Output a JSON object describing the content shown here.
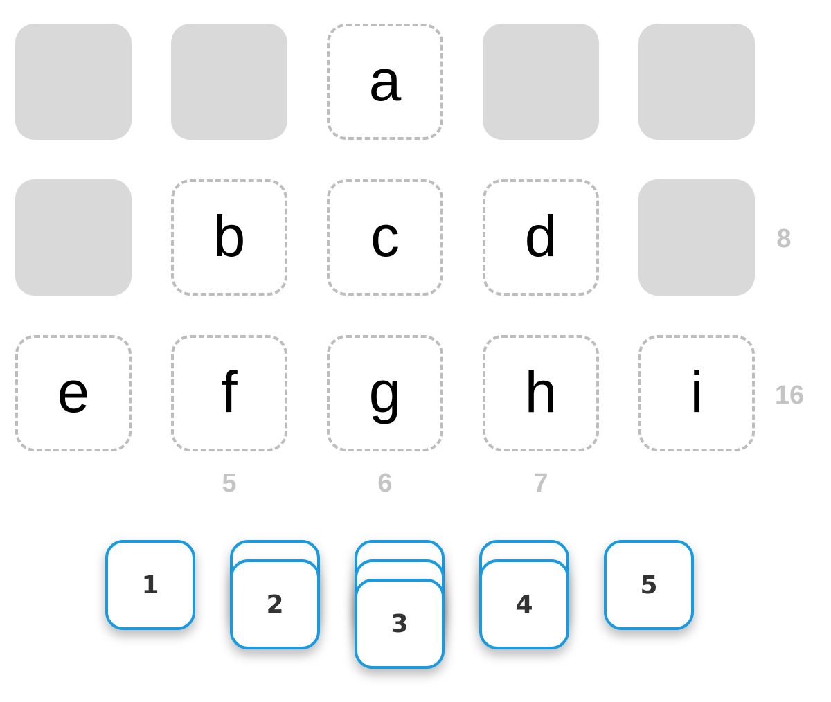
{
  "grid": {
    "row1": {
      "c3": "a"
    },
    "row2": {
      "c2": "b",
      "c3": "c",
      "c4": "d"
    },
    "row3": {
      "c1": "e",
      "c2": "f",
      "c3": "g",
      "c4": "h",
      "c5": "i"
    }
  },
  "clues": {
    "row2": "8",
    "row3": "16",
    "col2": "5",
    "col3": "6",
    "col4": "7"
  },
  "tiles": {
    "stack1": {
      "label": "1",
      "count": 1
    },
    "stack2": {
      "label": "2",
      "count": 2
    },
    "stack3": {
      "label": "3",
      "count": 3
    },
    "stack4": {
      "label": "4",
      "count": 2
    },
    "stack5": {
      "label": "5",
      "count": 1
    }
  },
  "colors": {
    "filled_cell": "#d9d9d9",
    "slot_border": "#bdbdbd",
    "clue_text": "#c4c4c4",
    "tile_border": "#1a9be0",
    "tile_text": "#333333"
  }
}
